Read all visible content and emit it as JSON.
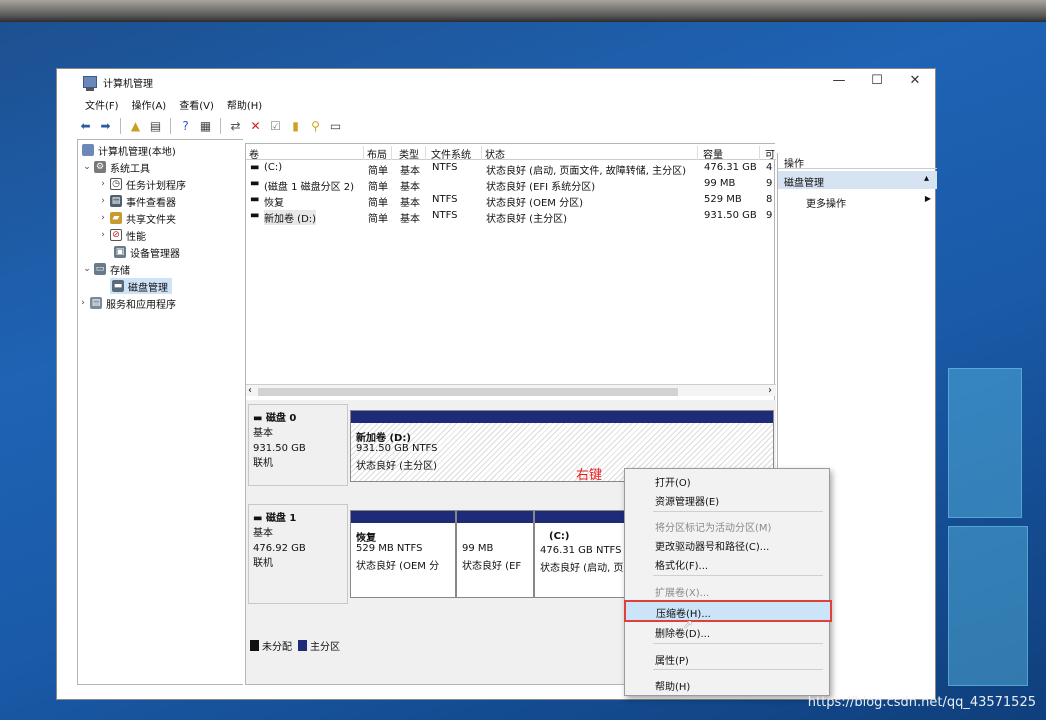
{
  "window": {
    "title": "计算机管理",
    "controls": {
      "minimize": "—",
      "maximize": "☐",
      "close": "✕"
    }
  },
  "menubar": [
    "文件(F)",
    "操作(A)",
    "查看(V)",
    "帮助(H)"
  ],
  "tree": {
    "root": "计算机管理(本地)",
    "items": [
      {
        "label": "系统工具"
      },
      {
        "label": "任务计划程序"
      },
      {
        "label": "事件查看器"
      },
      {
        "label": "共享文件夹"
      },
      {
        "label": "性能"
      },
      {
        "label": "设备管理器"
      },
      {
        "label": "存储"
      },
      {
        "label": "磁盘管理"
      },
      {
        "label": "服务和应用程序"
      }
    ]
  },
  "volume_table": {
    "columns": [
      "卷",
      "布局",
      "类型",
      "文件系统",
      "状态",
      "容量",
      "可"
    ],
    "rows": [
      {
        "vol": "(C:)",
        "layout": "简单",
        "type": "基本",
        "fs": "NTFS",
        "status": "状态良好 (启动, 页面文件, 故障转储, 主分区)",
        "capacity": "476.31 GB",
        "free": "4"
      },
      {
        "vol": "(磁盘 1 磁盘分区 2)",
        "layout": "简单",
        "type": "基本",
        "fs": "",
        "status": "状态良好 (EFI 系统分区)",
        "capacity": "99 MB",
        "free": "9"
      },
      {
        "vol": "恢复",
        "layout": "简单",
        "type": "基本",
        "fs": "NTFS",
        "status": "状态良好 (OEM 分区)",
        "capacity": "529 MB",
        "free": "8"
      },
      {
        "vol": "新加卷 (D:)",
        "layout": "简单",
        "type": "基本",
        "fs": "NTFS",
        "status": "状态良好 (主分区)",
        "capacity": "931.50 GB",
        "free": "9"
      }
    ]
  },
  "disks": [
    {
      "name": "磁盘 0",
      "type": "基本",
      "size": "931.50 GB",
      "status": "联机",
      "partitions": [
        {
          "title": "新加卷 (D:)",
          "size_fs": "931.50 GB NTFS",
          "status": "状态良好 (主分区)"
        }
      ]
    },
    {
      "name": "磁盘 1",
      "type": "基本",
      "size": "476.92 GB",
      "status": "联机",
      "partitions": [
        {
          "title": "恢复",
          "size_fs": "529 MB NTFS",
          "status": "状态良好 (OEM 分"
        },
        {
          "title": "",
          "size_fs": "99 MB",
          "status": "状态良好 (EF"
        },
        {
          "title": "(C:)",
          "size_fs": "476.31 GB NTFS",
          "status": "状态良好 (启动, 页"
        }
      ]
    }
  ],
  "legend": [
    {
      "label": "未分配",
      "color": "#111111"
    },
    {
      "label": "主分区",
      "color": "#1e2b78"
    }
  ],
  "actions": {
    "header": "操作",
    "section": "磁盘管理",
    "more": "更多操作"
  },
  "annotation": "右键",
  "context_menu": [
    {
      "label": "打开(O)",
      "enabled": true
    },
    {
      "label": "资源管理器(E)",
      "enabled": true
    },
    {
      "label": "将分区标记为活动分区(M)",
      "enabled": false
    },
    {
      "label": "更改驱动器号和路径(C)...",
      "enabled": true
    },
    {
      "label": "格式化(F)...",
      "enabled": true
    },
    {
      "label": "扩展卷(X)...",
      "enabled": false
    },
    {
      "label": "压缩卷(H)...",
      "enabled": true,
      "highlighted": true
    },
    {
      "label": "删除卷(D)...",
      "enabled": true
    },
    {
      "label": "属性(P)",
      "enabled": true
    },
    {
      "label": "帮助(H)",
      "enabled": true
    }
  ],
  "watermark": "https://blog.csdn.net/qq_43571525",
  "colors": {
    "primary_partition": "#1e2b78",
    "selection": "#cfe3f7",
    "highlight_border": "#e0403c",
    "annotation": "#e82020"
  }
}
